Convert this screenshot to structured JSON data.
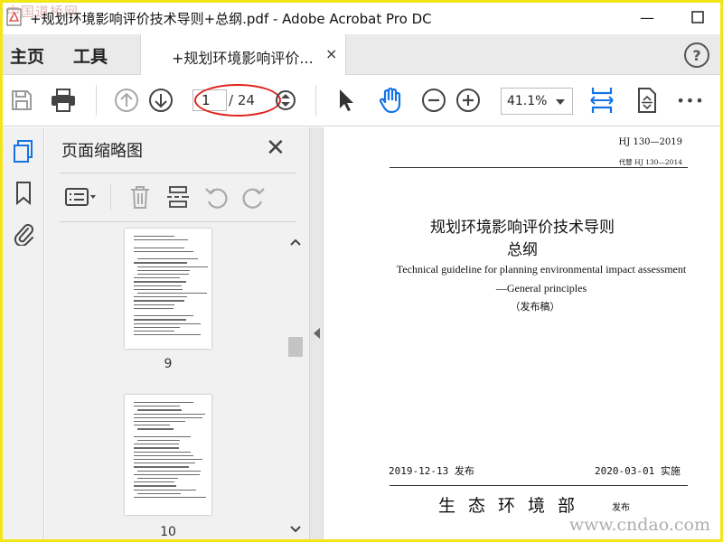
{
  "window": {
    "title": "+规划环境影响评价技术导则+总纲.pdf - Adobe Acrobat Pro DC",
    "minimize": "—",
    "maximize": "☐",
    "watermark_top": "中国道桥网"
  },
  "menu": {
    "home": "主页",
    "tools": "工具",
    "tab_label": "+规划环境影响评价...",
    "tab_close": "×",
    "help": "?"
  },
  "toolbar": {
    "current_page": "1",
    "total_pages": "/ 24",
    "zoom": "41.1%",
    "more": "•••",
    "highlight_color": "#e0201a",
    "accent_color": "#1473e6"
  },
  "thumbnail_pane": {
    "title": "页面缩略图",
    "close": "✕",
    "pages": [
      {
        "label": "9"
      },
      {
        "label": "10"
      }
    ]
  },
  "document": {
    "standard_no": "HJ 130—2019",
    "replaces": "代替 HJ 130—2014",
    "title_cn_line1": "规划环境影响评价技术导则",
    "title_cn_line2": "总纲",
    "title_en_line1": "Technical guideline for planning environmental impact assessment",
    "title_en_line2": "—General principles",
    "draft_note": "（发布稿）",
    "issue_date": "2019-12-13 发布",
    "effective_date": "2020-03-01 实施",
    "issuer": "生态环境部",
    "issuer_suffix": "发布"
  },
  "watermark_bottom": "www.cndao.com"
}
